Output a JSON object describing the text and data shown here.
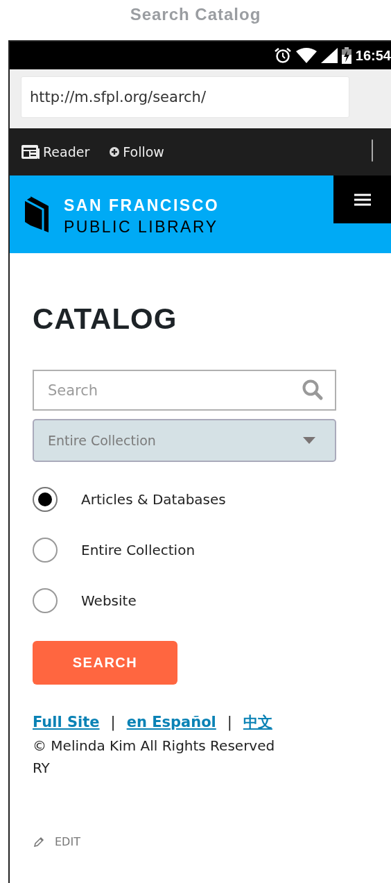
{
  "caption": "Search Catalog",
  "status_bar": {
    "time": "16:54"
  },
  "browser": {
    "url": "http://m.sfpl.org/search/",
    "toolbar": [
      {
        "kind": "reader",
        "label": "Reader"
      },
      {
        "kind": "follow",
        "label": "Follow"
      }
    ]
  },
  "header": {
    "line_1": "SAN FRANCISCO",
    "line_2": "PUBLIC LIBRARY"
  },
  "page_title": "CATALOG",
  "search": {
    "placeholder": "Search"
  },
  "collection_select": {
    "value": "Entire Collection"
  },
  "scopes": [
    {
      "label": "Articles & Databases",
      "selected": true
    },
    {
      "label": "Entire Collection",
      "selected": false
    },
    {
      "label": "Website",
      "selected": false
    }
  ],
  "search_button": "SEARCH",
  "footer_links": [
    {
      "kind": "link",
      "text": "Full Site"
    },
    {
      "kind": "separator",
      "text": "|"
    },
    {
      "kind": "link",
      "text": "en Español"
    },
    {
      "kind": "separator",
      "text": "|"
    },
    {
      "kind": "link",
      "text": "中文"
    }
  ],
  "copyright": "© Melinda Kim All Rights Reserved",
  "footer_note": "RY",
  "edit_link": "EDIT"
}
